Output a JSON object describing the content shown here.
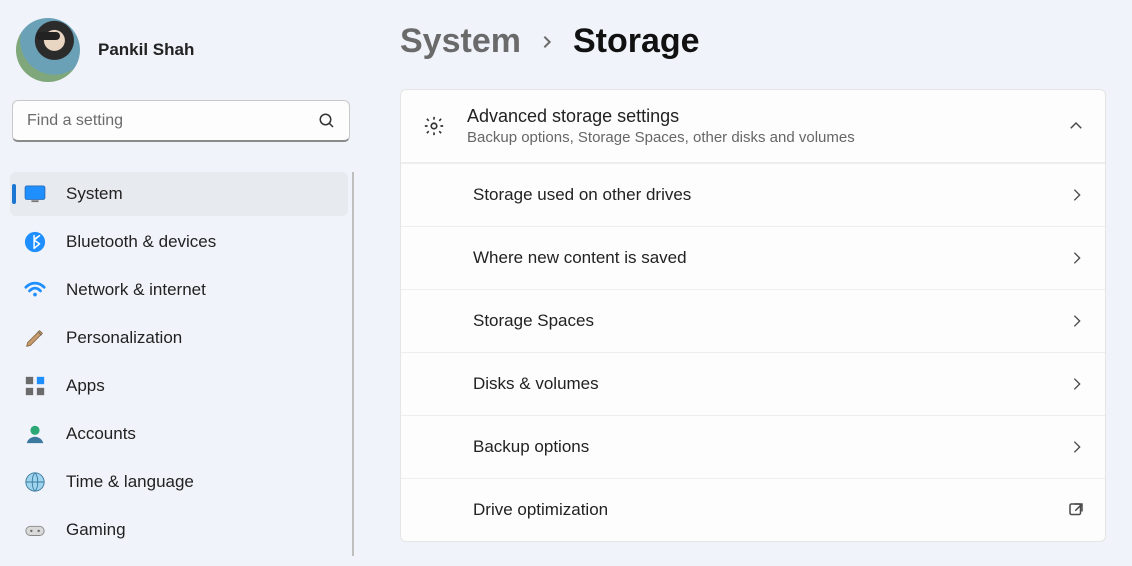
{
  "profile": {
    "name": "Pankil Shah"
  },
  "search": {
    "placeholder": "Find a setting"
  },
  "sidebar": {
    "items": [
      {
        "label": "System"
      },
      {
        "label": "Bluetooth & devices"
      },
      {
        "label": "Network & internet"
      },
      {
        "label": "Personalization"
      },
      {
        "label": "Apps"
      },
      {
        "label": "Accounts"
      },
      {
        "label": "Time & language"
      },
      {
        "label": "Gaming"
      }
    ]
  },
  "breadcrumb": {
    "parent": "System",
    "current": "Storage"
  },
  "advanced": {
    "title": "Advanced storage settings",
    "subtitle": "Backup options, Storage Spaces, other disks and volumes"
  },
  "rows": [
    {
      "label": "Storage used on other drives",
      "action": "chevron"
    },
    {
      "label": "Where new content is saved",
      "action": "chevron"
    },
    {
      "label": "Storage Spaces",
      "action": "chevron"
    },
    {
      "label": "Disks & volumes",
      "action": "chevron"
    },
    {
      "label": "Backup options",
      "action": "chevron"
    },
    {
      "label": "Drive optimization",
      "action": "external"
    }
  ]
}
